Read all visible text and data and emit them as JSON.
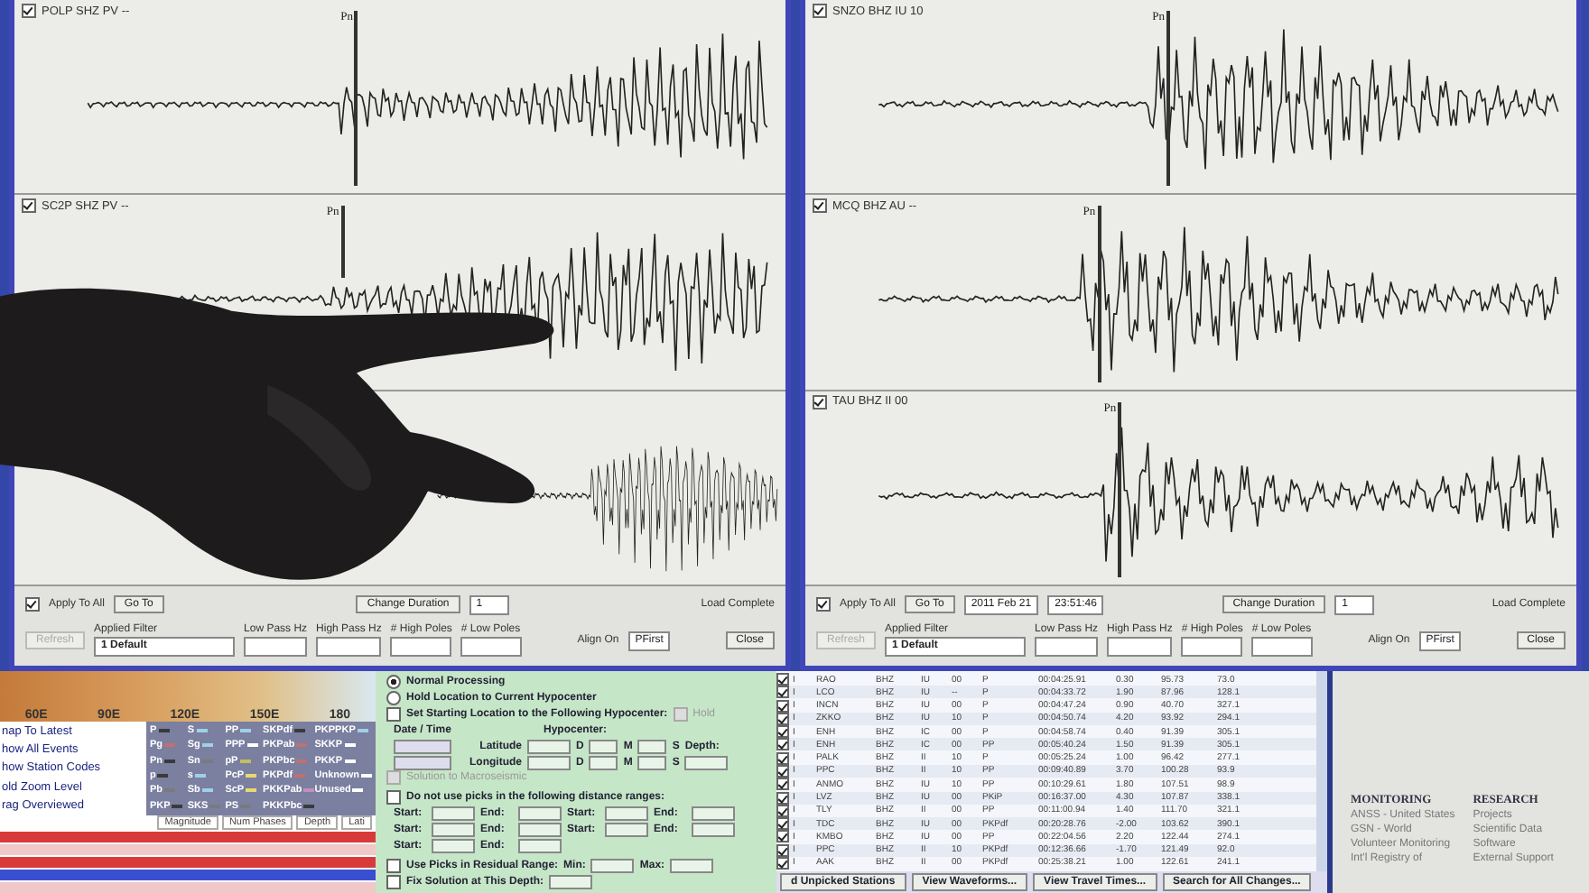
{
  "windows": [
    {
      "traces": [
        {
          "label": "POLP SHZ PV --",
          "checked": true,
          "marker": "Pn"
        },
        {
          "label": "SC2P SHZ PV --",
          "checked": true,
          "marker": "Pn"
        }
      ],
      "controls": {
        "apply_to_all": {
          "label": "Apply To All",
          "checked": true
        },
        "go_to": "Go To",
        "change_duration": "Change Duration",
        "duration": "1",
        "load_status": "Load Complete",
        "refresh": {
          "label": "Refresh",
          "disabled": true
        },
        "filter_label": "Applied Filter",
        "filter_value": "1 Default",
        "low_pass": "Low Pass Hz",
        "high_pass": "High Pass Hz",
        "high_poles": "# High Poles",
        "low_poles": "# Low Poles",
        "align_label": "Align On",
        "align_value": "PFirst",
        "close": "Close"
      }
    },
    {
      "traces": [
        {
          "label": "SNZO BHZ IU 10",
          "checked": true,
          "marker": "Pn"
        },
        {
          "label": "MCQ BHZ AU --",
          "checked": true,
          "marker": "Pn"
        },
        {
          "label": "TAU BHZ II 00",
          "checked": true,
          "marker": "Pn"
        }
      ],
      "controls": {
        "apply_to_all": {
          "label": "Apply To All",
          "checked": true
        },
        "go_to": "Go To",
        "date": "2011 Feb 21",
        "time": "23:51:46",
        "change_duration": "Change Duration",
        "duration": "1",
        "load_status": "Load Complete",
        "refresh": {
          "label": "Refresh",
          "disabled": true
        },
        "filter_label": "Applied Filter",
        "filter_value": "1 Default",
        "low_pass": "Low Pass Hz",
        "high_pass": "High Pass Hz",
        "high_poles": "# High Poles",
        "low_poles": "# Low Poles",
        "align_label": "Align On",
        "align_value": "PFirst",
        "close": "Close"
      }
    }
  ],
  "map": {
    "longitudes": [
      "60E",
      "90E",
      "120E",
      "150E",
      "180"
    ]
  },
  "map_menu": [
    "nap To Latest",
    "how All Events",
    "how Station Codes",
    "old Zoom Level",
    "rag Overviewed"
  ],
  "phase_legend": [
    {
      "name": "P",
      "color": "#3a3a3a"
    },
    {
      "name": "S",
      "color": "#9fd0e8"
    },
    {
      "name": "PP",
      "color": "#9fd0e8"
    },
    {
      "name": "SKPdf",
      "color": "#3a3a3a"
    },
    {
      "name": "PKPPKP",
      "color": "#9fd0e8"
    },
    {
      "name": "Pg",
      "color": "#c07070"
    },
    {
      "name": "Sg",
      "color": "#9fd0e8"
    },
    {
      "name": "PPP",
      "color": "#ffffff"
    },
    {
      "name": "PKPab",
      "color": "#c07070"
    },
    {
      "name": "SKKP",
      "color": "#ffffff"
    },
    {
      "name": "Pn",
      "color": "#3a3a3a"
    },
    {
      "name": "Sn",
      "color": "#7a7a7a"
    },
    {
      "name": "pP",
      "color": "#c0c060"
    },
    {
      "name": "PKPbc",
      "color": "#c07070"
    },
    {
      "name": "PKKP",
      "color": "#ffffff"
    },
    {
      "name": "p",
      "color": "#3a3a3a"
    },
    {
      "name": "s",
      "color": "#9fd0e8"
    },
    {
      "name": "PcP",
      "color": "#e8d870"
    },
    {
      "name": "PKPdf",
      "color": "#c07070"
    },
    {
      "name": "Unknown",
      "color": "#ffffff"
    },
    {
      "name": "Pb",
      "color": "#7a7a7a"
    },
    {
      "name": "Sb",
      "color": "#9fd0e8"
    },
    {
      "name": "ScP",
      "color": "#e8d870"
    },
    {
      "name": "PKKPab",
      "color": "#c090c0"
    },
    {
      "name": "Unused",
      "color": "#ffffff"
    },
    {
      "name": "PKP",
      "color": "#3a3a3a"
    },
    {
      "name": "SKS",
      "color": "#7a7a7a"
    },
    {
      "name": "PS",
      "color": "#7a7a7a"
    },
    {
      "name": "PKKPbc",
      "color": "#3a3a3a"
    }
  ],
  "event_table": {
    "columns": [
      "Magnitude",
      "Num Phases",
      "Depth",
      "Lati"
    ],
    "rows": [
      {
        "color": "#d83a3a"
      },
      {
        "color": "#f0c8c8"
      },
      {
        "color": "#d83a3a"
      },
      {
        "color": "#3a4fd0"
      },
      {
        "color": "#f0c8c8"
      }
    ]
  },
  "location_options": [
    {
      "kind": "radio",
      "label": "Normal Processing",
      "selected": true
    },
    {
      "kind": "radio",
      "label": "Hold Location to Current Hypocenter",
      "selected": false
    }
  ],
  "starting_location": {
    "label": "Set Starting Location to the Following Hypocenter:",
    "checked": false,
    "hold": {
      "label": "Hold",
      "disabled": true
    },
    "date_label": "Date / Time",
    "hypocenter_label": "Hypocenter:",
    "coordinates": [
      {
        "label": "Latitude",
        "degree": "D",
        "minute": "M",
        "second": "S",
        "depth": "Depth:"
      },
      {
        "label": "Longitude",
        "degree": "D",
        "minute": "M",
        "second": "S"
      }
    ],
    "macroseismic": {
      "label": "Solution to Macroseismic",
      "disabled": true
    }
  },
  "distance_ranges": {
    "label": "Do not use picks in the following distance ranges:",
    "checked": false,
    "fields": [
      [
        "Start:",
        "End:",
        "Start:",
        "End:"
      ],
      [
        "Start:",
        "End:",
        "Start:",
        "End:"
      ],
      [
        "Start:",
        "End:"
      ]
    ]
  },
  "residual": {
    "label": "Use Picks in Residual Range:",
    "checked": false,
    "min": "Min:",
    "max": "Max:"
  },
  "fix_depth": {
    "label": "Fix Solution at This Depth:",
    "checked": false
  },
  "station_table": {
    "rows": [
      {
        "checked": true,
        "cells": [
          "I",
          "RAO",
          "BHZ",
          "IU",
          "00",
          "P",
          "00:04:25.91",
          "0.30",
          "95.73",
          "73.0"
        ]
      },
      {
        "checked": true,
        "cells": [
          "I",
          "LCO",
          "BHZ",
          "IU",
          "--",
          "P",
          "00:04:33.72",
          "1.90",
          "87.96",
          "128.1"
        ]
      },
      {
        "checked": true,
        "cells": [
          "I",
          "INCN",
          "BHZ",
          "IU",
          "00",
          "P",
          "00:04:47.24",
          "0.90",
          "40.70",
          "327.1"
        ]
      },
      {
        "checked": true,
        "cells": [
          "I",
          "ZKKO",
          "BHZ",
          "IU",
          "10",
          "P",
          "00:04:50.74",
          "4.20",
          "93.92",
          "294.1"
        ]
      },
      {
        "checked": true,
        "cells": [
          "I",
          "ENH",
          "BHZ",
          "IC",
          "00",
          "P",
          "00:04:58.74",
          "0.40",
          "91.39",
          "305.1"
        ]
      },
      {
        "checked": true,
        "cells": [
          "I",
          "ENH",
          "BHZ",
          "IC",
          "00",
          "PP",
          "00:05:40.24",
          "1.50",
          "91.39",
          "305.1"
        ]
      },
      {
        "checked": true,
        "cells": [
          "I",
          "PALK",
          "BHZ",
          "II",
          "10",
          "P",
          "00:05:25.24",
          "1.00",
          "96.42",
          "277.1"
        ]
      },
      {
        "checked": true,
        "cells": [
          "I",
          "PPC",
          "BHZ",
          "II",
          "10",
          "PP",
          "00:09:40.89",
          "3.70",
          "100.28",
          "93.9"
        ]
      },
      {
        "checked": true,
        "cells": [
          "I",
          "ANMO",
          "BHZ",
          "IU",
          "10",
          "PP",
          "00:10:29.61",
          "1.80",
          "107.51",
          "98.9"
        ]
      },
      {
        "checked": true,
        "cells": [
          "I",
          "LVZ",
          "BHZ",
          "IU",
          "00",
          "PKiP",
          "00:16:37.00",
          "4.30",
          "107.87",
          "338.1"
        ]
      },
      {
        "checked": true,
        "cells": [
          "I",
          "TLY",
          "BHZ",
          "II",
          "00",
          "PP",
          "00:11:00.94",
          "1.40",
          "111.70",
          "321.1"
        ]
      },
      {
        "checked": true,
        "cells": [
          "I",
          "TDC",
          "BHZ",
          "IU",
          "00",
          "PKPdf",
          "00:20:28.76",
          "-2.00",
          "103.62",
          "390.1"
        ]
      },
      {
        "checked": true,
        "cells": [
          "I",
          "KMBO",
          "BHZ",
          "IU",
          "00",
          "PP",
          "00:22:04.56",
          "2.20",
          "122.44",
          "274.1"
        ]
      },
      {
        "checked": true,
        "cells": [
          "I",
          "PPC",
          "BHZ",
          "II",
          "10",
          "PKPdf",
          "00:12:36.66",
          "-1.70",
          "121.49",
          "92.0"
        ]
      },
      {
        "checked": true,
        "cells": [
          "I",
          "AAK",
          "BHZ",
          "II",
          "00",
          "PKPdf",
          "00:25:38.21",
          "1.00",
          "122.61",
          "241.1"
        ]
      }
    ]
  },
  "station_buttons": [
    "d Unpicked Stations",
    "View Waveforms...",
    "View Travel Times...",
    "Search for All Changes..."
  ],
  "link_columns": [
    {
      "heading": "MONITORING",
      "links": [
        "ANSS - United States",
        "GSN - World",
        "Volunteer Monitoring",
        "Int'l Registry of"
      ]
    },
    {
      "heading": "RESEARCH",
      "links": [
        "Projects",
        "Scientific Data",
        "Software",
        "External Support"
      ]
    }
  ]
}
